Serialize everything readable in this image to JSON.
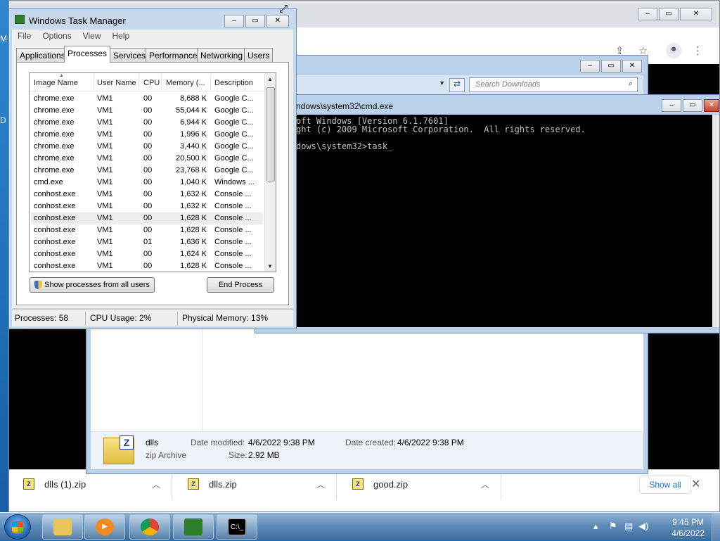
{
  "desktop": {
    "edge_letters": [
      "M",
      "D"
    ]
  },
  "taskmanager": {
    "title": "Windows Task Manager",
    "menu": [
      "File",
      "Options",
      "View",
      "Help"
    ],
    "tabs": [
      "Applications",
      "Processes",
      "Services",
      "Performance",
      "Networking",
      "Users"
    ],
    "active_tab": "Processes",
    "columns": [
      "Image Name",
      "User Name",
      "CPU",
      "Memory (...",
      "Description"
    ],
    "rows": [
      [
        "chrome.exe",
        "VM1",
        "00",
        "8,688 K",
        "Google C..."
      ],
      [
        "chrome.exe",
        "VM1",
        "00",
        "55,044 K",
        "Google C..."
      ],
      [
        "chrome.exe",
        "VM1",
        "00",
        "6,944 K",
        "Google C..."
      ],
      [
        "chrome.exe",
        "VM1",
        "00",
        "1,996 K",
        "Google C..."
      ],
      [
        "chrome.exe",
        "VM1",
        "00",
        "3,440 K",
        "Google C..."
      ],
      [
        "chrome.exe",
        "VM1",
        "00",
        "20,500 K",
        "Google C..."
      ],
      [
        "chrome.exe",
        "VM1",
        "00",
        "23,768 K",
        "Google C..."
      ],
      [
        "cmd.exe",
        "VM1",
        "00",
        "1,040 K",
        "Windows ..."
      ],
      [
        "conhost.exe",
        "VM1",
        "00",
        "1,632 K",
        "Console ..."
      ],
      [
        "conhost.exe",
        "VM1",
        "00",
        "1,632 K",
        "Console ..."
      ],
      [
        "conhost.exe",
        "VM1",
        "00",
        "1,628 K",
        "Console ..."
      ],
      [
        "conhost.exe",
        "VM1",
        "00",
        "1,628 K",
        "Console ..."
      ],
      [
        "conhost.exe",
        "VM1",
        "01",
        "1,636 K",
        "Console ..."
      ],
      [
        "conhost.exe",
        "VM1",
        "00",
        "1,624 K",
        "Console ..."
      ],
      [
        "conhost.exe",
        "VM1",
        "00",
        "1,628 K",
        "Console ..."
      ]
    ],
    "selected_row": 10,
    "show_all_label": "Show processes from all users",
    "end_process_label": "End Process",
    "status": {
      "processes": "Processes: 58",
      "cpu": "CPU Usage: 2%",
      "memory": "Physical Memory: 13%"
    }
  },
  "cmd": {
    "title": "ndows\\system32\\cmd.exe",
    "lines": [
      "oft Windows [Version 6.1.7601]",
      "ght (c) 2009 Microsoft Corporation.  All rights reserved.",
      "",
      "dows\\system32>task_"
    ]
  },
  "explorer": {
    "search_placeholder": "Search Downloads",
    "details": {
      "name": "dlls",
      "type": "zip Archive",
      "date_modified_label": "Date modified:",
      "date_modified": "4/6/2022 9:38 PM",
      "size_label": "Size:",
      "size": "2.92 MB",
      "date_created_label": "Date created:",
      "date_created": "4/6/2022 9:38 PM"
    }
  },
  "chrome": {
    "downloads": [
      {
        "name": "dlls (1).zip"
      },
      {
        "name": "dlls.zip"
      },
      {
        "name": "good.zip"
      }
    ],
    "show_all_label": "Show all"
  },
  "taskbar": {
    "time": "9:45 PM",
    "date": "4/6/2022",
    "apps": [
      "explorer-icon",
      "media-player-icon",
      "chrome-icon",
      "task-manager-icon",
      "cmd-icon"
    ]
  },
  "colors": {
    "desktop": "#1a64ad",
    "window_frame": "#b9d1ea",
    "chrome_link": "#1a73e8",
    "console_text": "#c0c0c0"
  }
}
